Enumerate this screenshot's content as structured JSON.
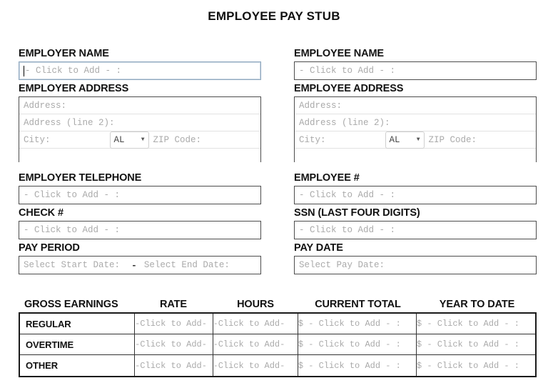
{
  "title": "EMPLOYEE PAY STUB",
  "placeholders": {
    "click_to_add": "- Click to Add - :",
    "click_to_add_compact": "-Click to Add-",
    "money_click_to_add": "$ - Click to Add - :",
    "address": "Address:",
    "address2": "Address (line 2):",
    "city": "City:",
    "zip": "ZIP Code:",
    "start_date": "Select Start Date:",
    "end_date": "Select End Date:",
    "pay_date": "Select Pay Date:"
  },
  "employer": {
    "name_label": "EMPLOYER NAME",
    "name_value": "",
    "address_label": "EMPLOYER ADDRESS",
    "state_value": "AL",
    "telephone_label": "EMPLOYER TELEPHONE",
    "check_label": "CHECK #",
    "pay_period_label": "PAY PERIOD",
    "period_separator": "-"
  },
  "employee": {
    "name_label": "EMPLOYEE NAME",
    "address_label": "EMPLOYEE ADDRESS",
    "state_value": "AL",
    "number_label": "EMPLOYEE #",
    "ssn_label": "SSN (LAST FOUR DIGITS)",
    "pay_date_label": "PAY DATE"
  },
  "earnings": {
    "headers": [
      "GROSS EARNINGS",
      "RATE",
      "HOURS",
      "CURRENT TOTAL",
      "YEAR TO DATE"
    ],
    "rows": [
      {
        "name": "REGULAR",
        "rate": "-Click to Add-",
        "hours": "-Click to Add-",
        "current": "$ - Click to Add - :",
        "ytd": "$ - Click to Add - :"
      },
      {
        "name": "OVERTIME",
        "rate": "-Click to Add-",
        "hours": "-Click to Add-",
        "current": "$ - Click to Add - :",
        "ytd": "$ - Click to Add - :"
      },
      {
        "name": "OTHER",
        "rate": "-Click to Add-",
        "hours": "-Click to Add-",
        "current": "$ - Click to Add - :",
        "ytd": "$ - Click to Add - :"
      }
    ]
  },
  "icons": {
    "chevron_down": "▼"
  }
}
